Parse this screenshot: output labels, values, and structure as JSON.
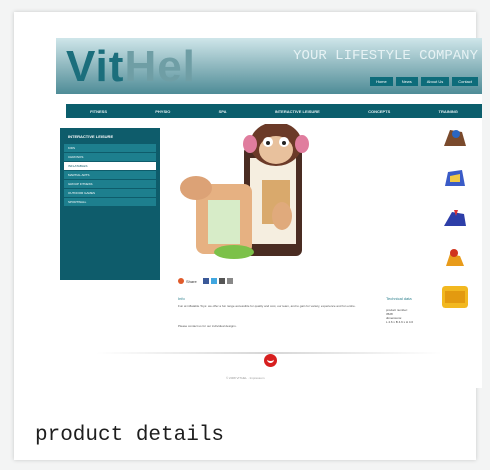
{
  "header": {
    "logo_part1": "Vit",
    "logo_part2": "Hel",
    "slogan": "YOUR LIFESTYLE COMPANY",
    "links": [
      "Home",
      "News",
      "About Us",
      "Contact"
    ]
  },
  "nav": [
    "FITNESS",
    "PHYSIO",
    "SPA",
    "INTERACTIVE LEISURE",
    "CONCEPTS",
    "TRAINING"
  ],
  "sidebar": {
    "title": "INTERACTIVE LEISURE",
    "items": [
      "KIDS",
      "CHRONOS",
      "INFLATABLES",
      "MARTIAL ARTS",
      "GROUP FITNESS",
      "OUTDOOR GAMES",
      "SPORTWALL"
    ],
    "active_index": 2
  },
  "share": {
    "label": "Share"
  },
  "info": {
    "title": "Info",
    "text": "Fun at inflatable Toys: we offer a fun range accessible for quality and cost, our team, and to gain for variety, experience and fun entire.",
    "text2": "Please contact us for our individual designs."
  },
  "technical": {
    "title": "Technical data",
    "product_number_label": "product number:",
    "product_number_value": "3528",
    "dimensions_label": "dimensions:",
    "dimensions_value": "L 4.6 x B 4.6 x H 4.6"
  },
  "footer": {
    "copyright": "© 2008 VITHEL · Impressum"
  },
  "caption": "product details",
  "colors": {
    "brand": "#0e5c6b",
    "accent": "#d71f1f"
  }
}
